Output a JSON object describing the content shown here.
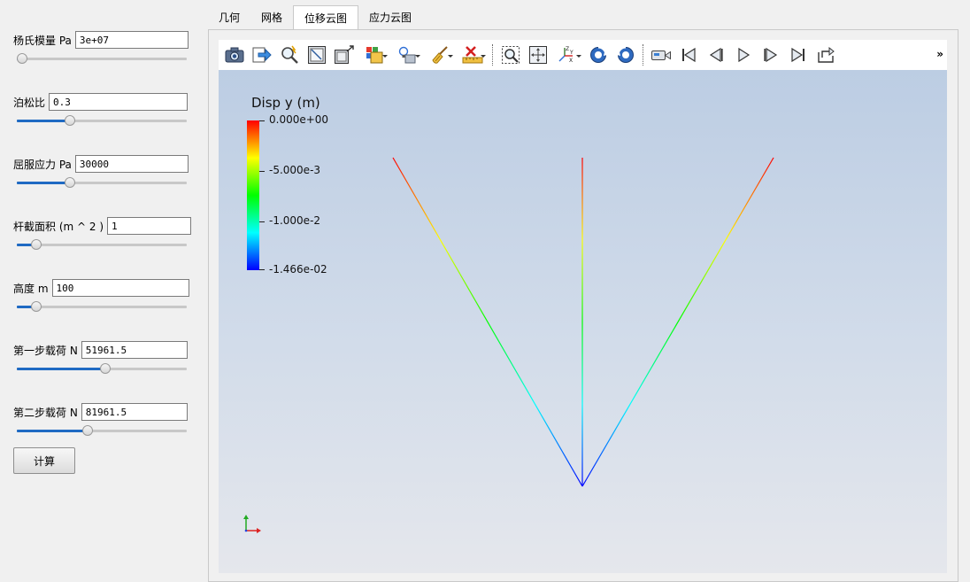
{
  "params": [
    {
      "label": "杨氏模量 Pa",
      "value": "3e+07",
      "slider": 0.0
    },
    {
      "label": "泊松比",
      "value": "0.3",
      "slider": 0.3
    },
    {
      "label": "屈服应力 Pa",
      "value": "30000",
      "slider": 0.3
    },
    {
      "label": "杆截面积 (m ^ 2 )",
      "value": "1",
      "slider": 0.09
    },
    {
      "label": "高度 m",
      "value": "100",
      "slider": 0.09
    },
    {
      "label": "第一步载荷 N",
      "value": "51961.5",
      "slider": 0.52
    },
    {
      "label": "第二步载荷 N",
      "value": "81961.5",
      "slider": 0.41
    }
  ],
  "calc_button": "计算",
  "tabs": [
    {
      "label": "几何",
      "active": false
    },
    {
      "label": "网格",
      "active": false
    },
    {
      "label": "位移云图",
      "active": true
    },
    {
      "label": "应力云图",
      "active": false
    }
  ],
  "toolbar": {
    "icons": [
      "camera-icon",
      "export-icon",
      "find-data-icon",
      "reset-camera-icon",
      "zoom-data-icon",
      "view-layers-icon",
      "lights-icon",
      "clear-icon",
      "ruler-icon",
      "zoom-box-icon",
      "pick-center-icon",
      "axes-icon",
      "rotate-cw-icon",
      "rotate-ccw-icon",
      "camera-record-icon",
      "first-frame-icon",
      "prev-frame-icon",
      "play-icon",
      "next-frame-icon",
      "last-frame-icon",
      "loop-icon"
    ],
    "overflow": "»"
  },
  "legend": {
    "title": "Disp y (m)",
    "ticks": [
      "0.000e+00",
      "-5.000e-3",
      "-1.000e-2",
      "-1.466e-02"
    ]
  },
  "colors": {
    "accent": "#1f6ac3"
  }
}
